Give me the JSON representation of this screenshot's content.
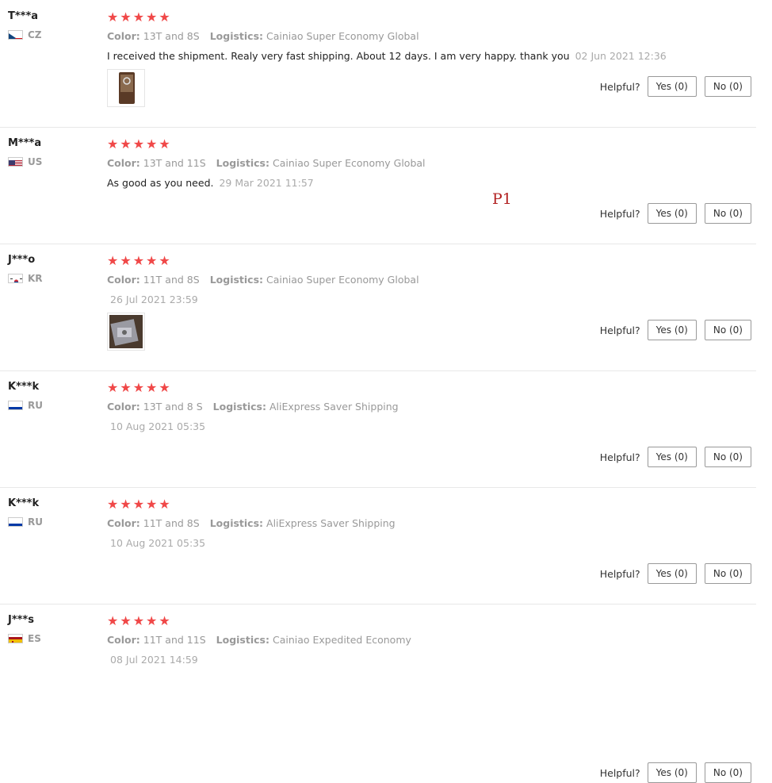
{
  "reviews": [
    {
      "user": "T***a",
      "country": "CZ",
      "stars": 5,
      "color_label": "Color:",
      "color_value": "13T and 8S",
      "logistics_label": "Logistics:",
      "logistics_value": "Cainiao Super Economy Global",
      "text": "I received the shipment. Realy very fast shipping. About 12 days. I am very happy. thank you",
      "date": "02 Jun 2021 12:36",
      "has_photo": true,
      "helpful_label": "Helpful?",
      "yes_label": "Yes (0)",
      "no_label": "No (0)"
    },
    {
      "user": "M***a",
      "country": "US",
      "stars": 5,
      "color_label": "Color:",
      "color_value": "13T and 11S",
      "logistics_label": "Logistics:",
      "logistics_value": "Cainiao Super Economy Global",
      "text": "As good as you need.",
      "date": "29 Mar 2021 11:57",
      "has_photo": false,
      "helpful_label": "Helpful?",
      "yes_label": "Yes (0)",
      "no_label": "No (0)"
    },
    {
      "user": "J***o",
      "country": "KR",
      "stars": 5,
      "color_label": "Color:",
      "color_value": "11T and 8S",
      "logistics_label": "Logistics:",
      "logistics_value": "Cainiao Super Economy Global",
      "text": "",
      "date": "26 Jul 2021 23:59",
      "has_photo": true,
      "helpful_label": "Helpful?",
      "yes_label": "Yes (0)",
      "no_label": "No (0)"
    },
    {
      "user": "K***k",
      "country": "RU",
      "stars": 5,
      "color_label": "Color:",
      "color_value": "13T and 8 S",
      "logistics_label": "Logistics:",
      "logistics_value": "AliExpress Saver Shipping",
      "text": "",
      "date": "10 Aug 2021 05:35",
      "has_photo": false,
      "helpful_label": "Helpful?",
      "yes_label": "Yes (0)",
      "no_label": "No (0)"
    },
    {
      "user": "K***k",
      "country": "RU",
      "stars": 5,
      "color_label": "Color:",
      "color_value": "11T and 8S",
      "logistics_label": "Logistics:",
      "logistics_value": "AliExpress Saver Shipping",
      "text": "",
      "date": "10 Aug 2021 05:35",
      "has_photo": false,
      "helpful_label": "Helpful?",
      "yes_label": "Yes (0)",
      "no_label": "No (0)"
    },
    {
      "user": "J***s",
      "country": "ES",
      "stars": 5,
      "color_label": "Color:",
      "color_value": "11T and 11S",
      "logistics_label": "Logistics:",
      "logistics_value": "Cainiao Expedited Economy",
      "text": "",
      "date": "08 Jul 2021 14:59",
      "has_photo": false,
      "helpful_label": "Helpful?",
      "yes_label": "Yes (0)",
      "no_label": "No (0)"
    }
  ],
  "overlay_label": "P1",
  "colors": {
    "star": "#f04848",
    "muted": "#999999",
    "date": "#aaaaaa",
    "overlay": "#b22222"
  },
  "icons": {
    "star": "star-icon",
    "flag": "country-flag-icon",
    "photo": "review-photo"
  }
}
